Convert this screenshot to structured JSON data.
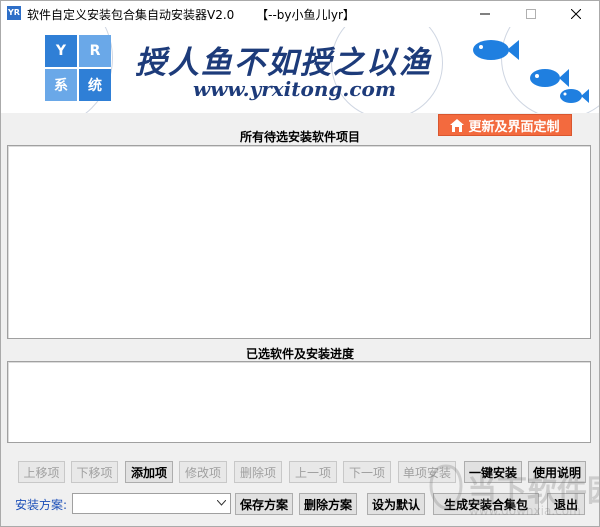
{
  "window": {
    "icon_text": "YR",
    "title": "软件自定义安装包合集自动安装器V2.0",
    "author": "【--by小鱼儿lyr】"
  },
  "banner": {
    "logo_chars": [
      "Y",
      "R",
      "系",
      "统"
    ],
    "slogan": "授人鱼不如授之以渔",
    "url": "www.yrxitong.com"
  },
  "update_button": {
    "label": "更新及界面定制",
    "icon": "home-icon"
  },
  "sections": {
    "available_label": "所有待选安装软件项目",
    "selected_label": "已选软件及安装进度"
  },
  "buttons": {
    "move_up": "上移项",
    "move_down": "下移项",
    "add": "添加项",
    "edit": "修改项",
    "delete": "删除项",
    "prev": "上一项",
    "next": "下一项",
    "single_install": "单项安装",
    "one_click_install": "一键安装",
    "help": "使用说明",
    "save_scheme": "保存方案",
    "delete_scheme": "删除方案",
    "set_default": "设为默认",
    "generate_package": "生成安装合集包",
    "exit": "退出"
  },
  "scheme": {
    "label": "安装方案:",
    "value": ""
  },
  "watermark": {
    "text": "当下软件园",
    "sub": "www.downxia.com"
  },
  "colors": {
    "accent": "#f36a3e",
    "label_blue": "#1c4fb8",
    "banner_text": "#1d3b7a"
  }
}
